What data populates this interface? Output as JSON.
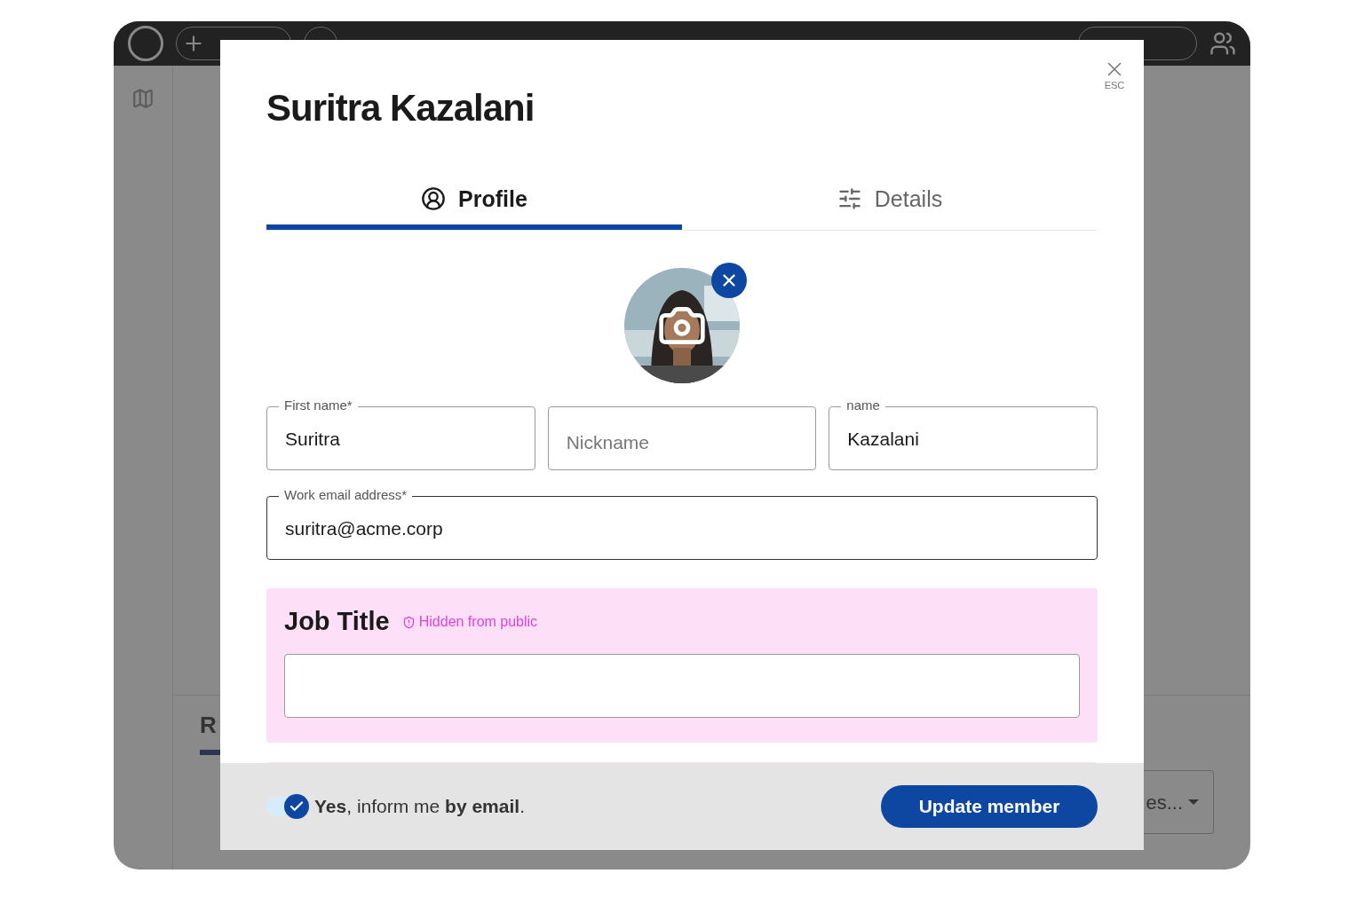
{
  "background": {
    "tab_label": "R",
    "dropdown_value": "es..."
  },
  "modal": {
    "title": "Suritra Kazalani",
    "close_hint": "ESC",
    "tabs": [
      {
        "label": "Profile",
        "selected": true
      },
      {
        "label": "Details",
        "selected": false
      }
    ],
    "fields": [
      {
        "label": "First name*",
        "value": "Suritra"
      },
      {
        "placeholder": "Nickname"
      },
      {
        "label": "name",
        "value": "Kazalani"
      }
    ],
    "email": {
      "label": "Work email address*",
      "value": "suritra@acme.corp"
    },
    "job_title": {
      "heading": "Job Title",
      "badge": "Hidden from public"
    },
    "footer": {
      "notify": {
        "on": true,
        "text": "**Yes**, inform me **by email**."
      },
      "submit": "Update member"
    }
  }
}
